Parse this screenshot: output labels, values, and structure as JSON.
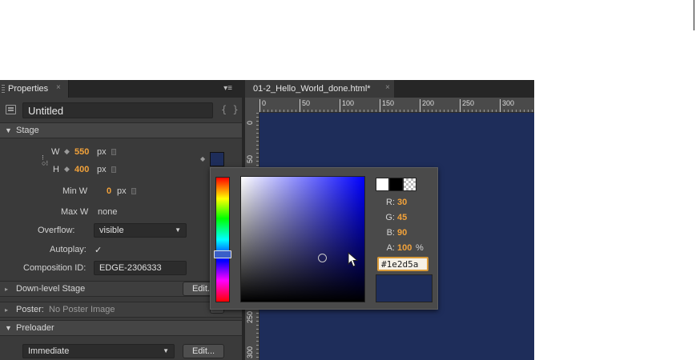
{
  "properties_panel": {
    "tab_label": "Properties",
    "tab_close": "×",
    "menu_glyph": "▾≡",
    "composition_name": "Untitled",
    "code_glyph": "{ }",
    "stage": {
      "section_label": "Stage",
      "w_label": "W",
      "w_value": "550",
      "h_label": "H",
      "h_value": "400",
      "unit": "px",
      "min_w_label": "Min W",
      "min_w_value": "0",
      "max_w_label": "Max W",
      "max_w_value": "none",
      "overflow_label": "Overflow:",
      "overflow_value": "visible",
      "autoplay_label": "Autoplay:",
      "autoplay_check": "✓",
      "composition_id_label": "Composition ID:",
      "composition_id_value": "EDGE-2306333",
      "background_color": "#1e2d5a"
    },
    "down_level_stage_label": "Down-level Stage",
    "edit_label": "Edit...",
    "poster_label": "Poster:",
    "poster_value": "No Poster Image",
    "preloader_label": "Preloader",
    "preloader_value": "Immediate"
  },
  "document": {
    "tab_label": "01-2_Hello_World_done.html*",
    "tab_close": "×",
    "ruler_top_ticks": [
      "0",
      "50",
      "100",
      "150",
      "200",
      "250",
      "300"
    ],
    "ruler_left_ticks": [
      "0",
      "50",
      "250",
      "300"
    ],
    "stage_color": "#1e2d5a"
  },
  "color_picker": {
    "r_label": "R:",
    "r_value": "30",
    "g_label": "G:",
    "g_value": "45",
    "b_label": "B:",
    "b_value": "90",
    "a_label": "A:",
    "a_value": "100",
    "a_unit": "%",
    "hex_value": "#1e2d5a",
    "preview_color": "#1e2d5a"
  }
}
